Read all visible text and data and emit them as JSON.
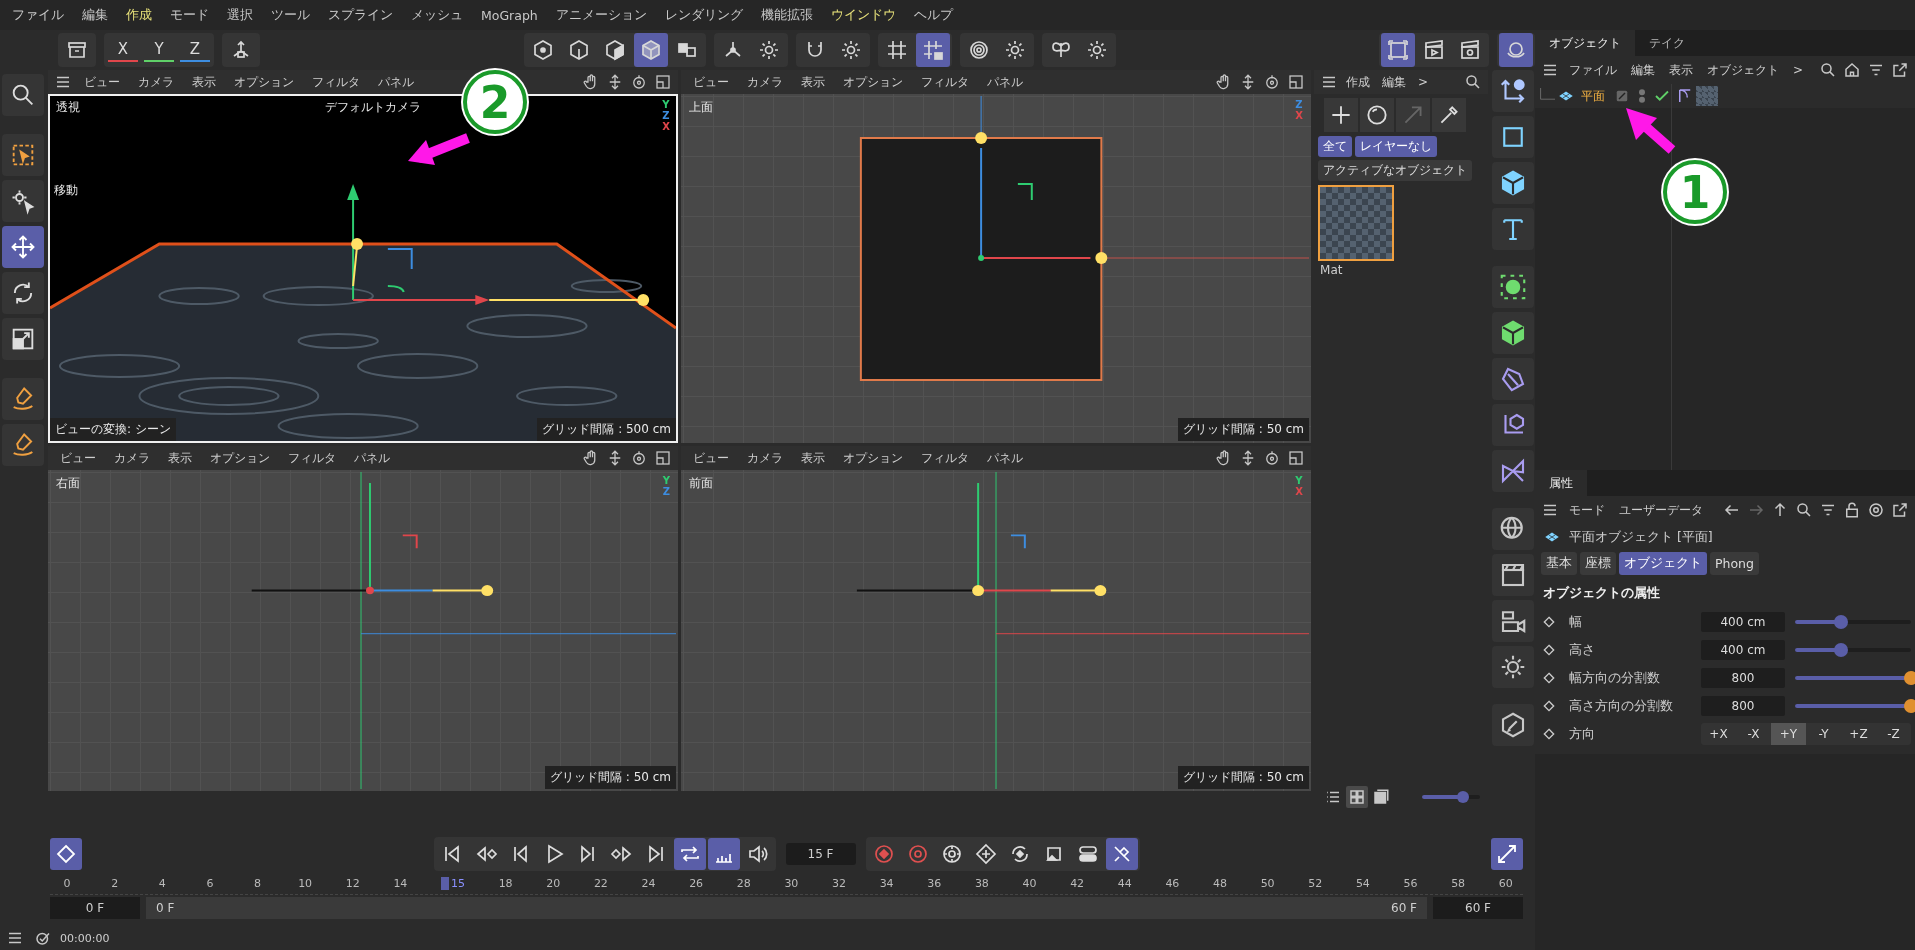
{
  "menu_bar": [
    {
      "label": "ファイル",
      "highlighted": false
    },
    {
      "label": "編集",
      "highlighted": false
    },
    {
      "label": "作成",
      "highlighted": true
    },
    {
      "label": "モード",
      "highlighted": false
    },
    {
      "label": "選択",
      "highlighted": false
    },
    {
      "label": "ツール",
      "highlighted": false
    },
    {
      "label": "スプライン",
      "highlighted": false
    },
    {
      "label": "メッシュ",
      "highlighted": false
    },
    {
      "label": "MoGraph",
      "highlighted": false
    },
    {
      "label": "アニメーション",
      "highlighted": false
    },
    {
      "label": "レンダリング",
      "highlighted": false
    },
    {
      "label": "機能拡張",
      "highlighted": false
    },
    {
      "label": "ウインドウ",
      "highlighted": true
    },
    {
      "label": "ヘルプ",
      "highlighted": false
    }
  ],
  "toolbar": {
    "axes": [
      {
        "label": "X",
        "color": "#e0464b"
      },
      {
        "label": "Y",
        "color": "#5fd068"
      },
      {
        "label": "Z",
        "color": "#3d8de0"
      }
    ],
    "tools": [
      {
        "selected": false
      },
      {
        "selected": false
      },
      {
        "selected": false
      },
      {
        "selected": false
      },
      {
        "selected": false
      },
      {
        "selected": true
      },
      {
        "selected": false
      },
      {
        "selected": false
      },
      {
        "selected": false
      },
      {
        "selected": false
      },
      {
        "selected": false
      },
      {
        "selected": false
      },
      {
        "selected": true
      },
      {
        "selected": false
      },
      {
        "selected": false
      },
      {
        "selected": false
      },
      {
        "selected": false
      },
      {
        "selected": true
      },
      {
        "selected": false
      },
      {
        "selected": false
      },
      {
        "selected": true
      }
    ]
  },
  "left_tools": [
    {
      "selected": false
    },
    {
      "selected": false
    },
    {
      "selected": false
    },
    {
      "selected": true
    },
    {
      "selected": false
    },
    {
      "selected": false
    },
    {
      "selected": false
    },
    {
      "selected": false
    }
  ],
  "viewports": [
    {
      "kind": "perspective",
      "selected": true,
      "menu": [
        "ビュー",
        "カメラ",
        "表示",
        "オプション",
        "フィルタ",
        "パネル"
      ],
      "name": "透視",
      "camera": "デフォルトカメラ",
      "tool": "移動",
      "transform": "ビューの変換: シーン",
      "grid": "グリッド間隔 : 500 cm",
      "axes": [
        {
          "label": "Y",
          "color": "#2ecc71"
        },
        {
          "label": "Z",
          "color": "#3d8de0"
        },
        {
          "label": "X",
          "color": "#e0464b"
        }
      ]
    },
    {
      "kind": "top",
      "selected": false,
      "menu": [
        "ビュー",
        "カメラ",
        "表示",
        "オプション",
        "フィルタ",
        "パネル"
      ],
      "name": "上面",
      "grid": "グリッド間隔 : 50 cm",
      "axes": [
        {
          "label": "Z",
          "color": "#3d8de0"
        },
        {
          "label": "X",
          "color": "#e0464b"
        }
      ]
    },
    {
      "kind": "right",
      "selected": false,
      "menu": [
        "ビュー",
        "カメラ",
        "表示",
        "オプション",
        "フィルタ",
        "パネル"
      ],
      "name": "右面",
      "grid": "グリッド間隔 : 50 cm",
      "axes": [
        {
          "label": "Y",
          "color": "#2ecc71"
        },
        {
          "label": "Z",
          "color": "#3d8de0"
        }
      ]
    },
    {
      "kind": "front",
      "selected": false,
      "menu": [
        "ビュー",
        "カメラ",
        "表示",
        "オプション",
        "フィルタ",
        "パネル"
      ],
      "name": "前面",
      "grid": "グリッド間隔 : 50 cm",
      "axes": [
        {
          "label": "Y",
          "color": "#2ecc71"
        },
        {
          "label": "X",
          "color": "#e0464b"
        }
      ]
    }
  ],
  "material_manager": {
    "menu": [
      "作成",
      "編集",
      ">"
    ],
    "filters": [
      {
        "label": "全て",
        "selected": true
      },
      {
        "label": "レイヤーなし",
        "selected": true
      },
      {
        "label": "アクティブなオブジェクト",
        "selected": false
      }
    ],
    "materials": [
      {
        "name": "Mat",
        "selected": true
      }
    ],
    "zoom": {
      "level": 0.7
    }
  },
  "object_manager": {
    "tabs": [
      {
        "label": "オブジェクト",
        "selected": true
      },
      {
        "label": "テイク",
        "selected": false
      }
    ],
    "menu": [
      "ファイル",
      "編集",
      "表示",
      "オブジェクト",
      ">"
    ],
    "objects": [
      {
        "name": "平面",
        "selected": true,
        "enabled": true
      }
    ]
  },
  "attributes": {
    "tab": "属性",
    "menu": [
      "モード",
      "ユーザーデータ"
    ],
    "title": "平面オブジェクト [平面]",
    "tabs": [
      {
        "label": "基本",
        "selected": false
      },
      {
        "label": "座標",
        "selected": false
      },
      {
        "label": "オブジェクト",
        "selected": true
      },
      {
        "label": "Phong",
        "selected": false
      }
    ],
    "section": "オブジェクトの属性",
    "params": [
      {
        "kind": "slider",
        "label": "幅",
        "value": "400 cm",
        "level": 0.4
      },
      {
        "kind": "slider",
        "label": "高さ",
        "value": "400 cm",
        "level": 0.4
      },
      {
        "kind": "slider",
        "label": "幅方向の分割数",
        "value": "800",
        "level": 1
      },
      {
        "kind": "slider",
        "label": "高さ方向の分割数",
        "value": "800",
        "level": 1
      },
      {
        "kind": "choice",
        "label": "方向",
        "options": [
          {
            "label": "+X",
            "selected": false
          },
          {
            "label": "-X",
            "selected": false
          },
          {
            "label": "+Y",
            "selected": true
          },
          {
            "label": "-Y",
            "selected": false
          },
          {
            "label": "+Z",
            "selected": false
          },
          {
            "label": "-Z",
            "selected": false
          }
        ]
      }
    ]
  },
  "timeline": {
    "frame": "15 F",
    "buttons": [
      {
        "selected": false
      },
      {
        "selected": false
      },
      {
        "selected": false
      },
      {
        "selected": false
      },
      {
        "selected": false
      },
      {
        "selected": false
      },
      {
        "selected": false
      },
      {
        "selected": true
      },
      {
        "selected": true
      },
      {
        "selected": false
      }
    ],
    "keys": [
      {
        "selected": false
      },
      {
        "selected": false
      },
      {
        "selected": false
      },
      {
        "selected": false
      },
      {
        "selected": false
      },
      {
        "selected": false
      },
      {
        "selected": false
      },
      {
        "selected": true
      }
    ],
    "ticks": [
      {
        "label": "0",
        "current": false
      },
      {
        "label": "2",
        "current": false
      },
      {
        "label": "4",
        "current": false
      },
      {
        "label": "6",
        "current": false
      },
      {
        "label": "8",
        "current": false
      },
      {
        "label": "10",
        "current": false
      },
      {
        "label": "12",
        "current": false
      },
      {
        "label": "14",
        "current": false
      },
      {
        "label": "15",
        "current": true
      },
      {
        "label": "18",
        "current": false
      },
      {
        "label": "20",
        "current": false
      },
      {
        "label": "22",
        "current": false
      },
      {
        "label": "24",
        "current": false
      },
      {
        "label": "26",
        "current": false
      },
      {
        "label": "28",
        "current": false
      },
      {
        "label": "30",
        "current": false
      },
      {
        "label": "32",
        "current": false
      },
      {
        "label": "34",
        "current": false
      },
      {
        "label": "36",
        "current": false
      },
      {
        "label": "38",
        "current": false
      },
      {
        "label": "40",
        "current": false
      },
      {
        "label": "42",
        "current": false
      },
      {
        "label": "44",
        "current": false
      },
      {
        "label": "46",
        "current": false
      },
      {
        "label": "48",
        "current": false
      },
      {
        "label": "50",
        "current": false
      },
      {
        "label": "52",
        "current": false
      },
      {
        "label": "54",
        "current": false
      },
      {
        "label": "56",
        "current": false
      },
      {
        "label": "58",
        "current": false
      },
      {
        "label": "60",
        "current": false
      }
    ],
    "start": "0 F",
    "range_start": "0 F",
    "range_end": "60 F",
    "end": "60 F"
  },
  "status_bar": {
    "time": "00:00:00"
  },
  "annotations": [
    {
      "label": "1"
    },
    {
      "label": "2"
    }
  ]
}
